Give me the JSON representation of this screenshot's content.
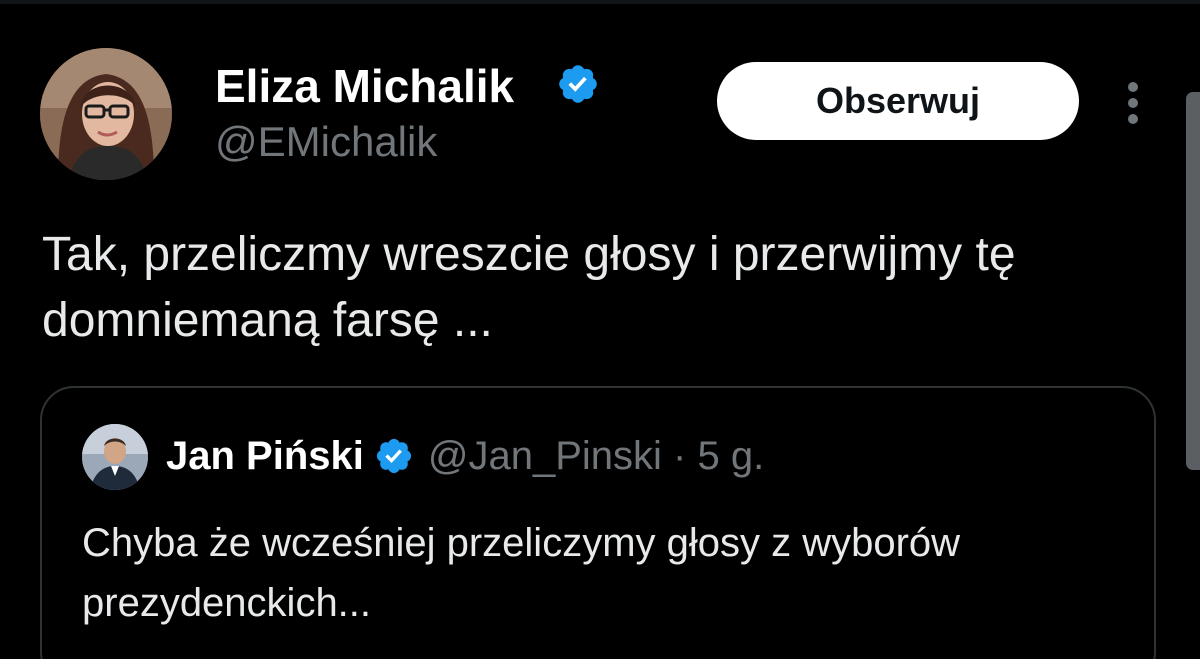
{
  "tweet": {
    "author_name": "Eliza Michalik",
    "author_handle": "@EMichalik",
    "verified": true,
    "follow_label": "Obserwuj",
    "text": "Tak, przeliczmy wreszcie głosy i przerwijmy tę domniemaną farsę ..."
  },
  "quoted_tweet": {
    "author_name": "Jan Piński",
    "author_handle": "@Jan_Pinski",
    "separator": "·",
    "timestamp": "5 g.",
    "verified": true,
    "text": "Chyba że wcześniej przeliczymy głosy z wyborów prezydenckich..."
  },
  "icons": {
    "verified": "verified-badge-icon",
    "more": "more-vertical-icon"
  },
  "colors": {
    "background": "#000000",
    "primary_text": "#e7e9ea",
    "secondary_text": "#71767b",
    "verified_blue": "#1d9bf0",
    "follow_button_bg": "#ffffff",
    "card_border": "#2f3336"
  }
}
